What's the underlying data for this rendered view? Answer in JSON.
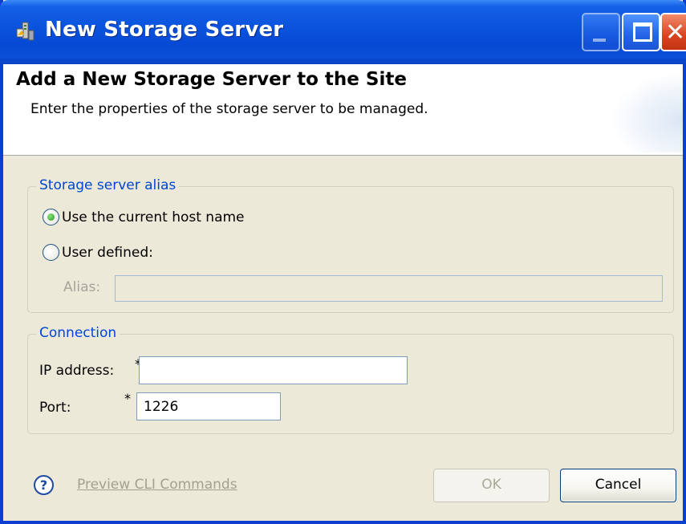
{
  "window": {
    "title": "New Storage Server",
    "close_glyph": "✕"
  },
  "header": {
    "title": "Add a New Storage Server to the Site",
    "description": "Enter the properties of the storage server to be managed."
  },
  "alias_group": {
    "legend": "Storage server alias",
    "option_current_host": "Use the current host name",
    "option_user_defined": "User defined:",
    "selected": "current_host",
    "alias_label": "Alias:",
    "alias_value": ""
  },
  "connection_group": {
    "legend": "Connection",
    "ip_label": "IP address:",
    "ip_value": "",
    "port_label": "Port:",
    "port_value": "1226",
    "required_marker": "*"
  },
  "footer": {
    "help_glyph": "?",
    "preview_link": "Preview CLI Commands",
    "ok_label": "OK",
    "cancel_label": "Cancel"
  },
  "colors": {
    "titlebar": "#0a52dd",
    "dialog_bg": "#ece9d8",
    "legend_text": "#0046d5",
    "disabled_text": "#aca899"
  },
  "icons": [
    "app-icon",
    "minimize-icon",
    "maximize-icon",
    "close-icon",
    "help-icon"
  ]
}
